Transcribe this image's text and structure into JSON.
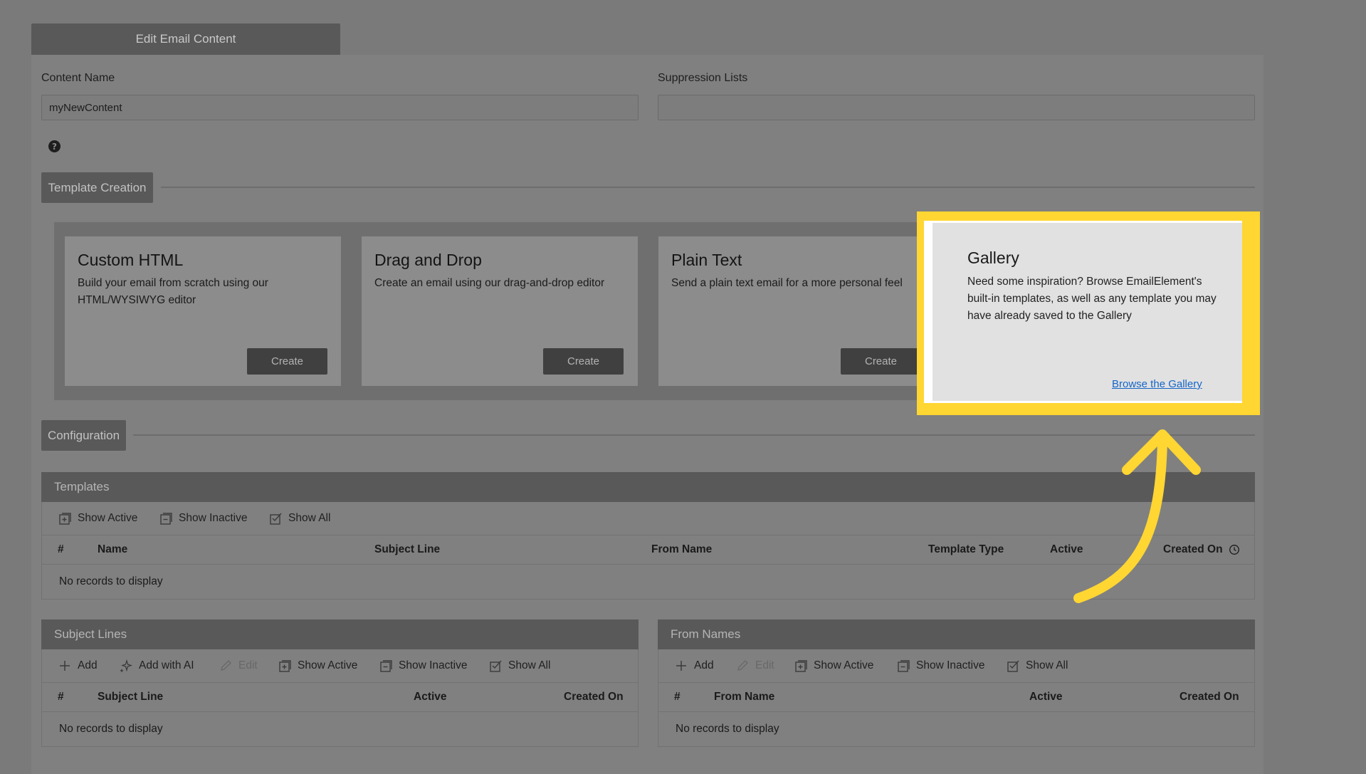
{
  "header": {
    "tab_label": "Edit Email Content"
  },
  "form": {
    "content_name_label": "Content Name",
    "content_name_value": "myNewContent",
    "suppression_label": "Suppression Lists",
    "suppression_value": "",
    "help_glyph": "?"
  },
  "template_creation": {
    "section_label": "Template Creation",
    "cards": [
      {
        "title": "Custom HTML",
        "description": "Build your email from scratch using our HTML/WYSIWYG editor",
        "button": "Create"
      },
      {
        "title": "Drag and Drop",
        "description": "Create an email using our drag-and-drop editor",
        "button": "Create"
      },
      {
        "title": "Plain Text",
        "description": "Send a plain text email for a more personal feel",
        "button": "Create"
      }
    ],
    "gallery": {
      "title": "Gallery",
      "description": "Need some inspiration? Browse EmailElement's built-in templates, as well as any template you may have already saved to the Gallery",
      "link": "Browse the Gallery"
    }
  },
  "configuration": {
    "section_label": "Configuration"
  },
  "templates_grid": {
    "title": "Templates",
    "toolbar": [
      "Show Active",
      "Show Inactive",
      "Show All"
    ],
    "columns": [
      "#",
      "Name",
      "Subject Line",
      "From Name",
      "Template Type",
      "Active",
      "Created On"
    ],
    "empty": "No records to display"
  },
  "subject_lines_grid": {
    "title": "Subject Lines",
    "toolbar": [
      "Add",
      "Add with AI",
      "Edit",
      "Show Active",
      "Show Inactive",
      "Show All"
    ],
    "columns": [
      "#",
      "Subject Line",
      "Active",
      "Created On"
    ],
    "empty": "No records to display"
  },
  "from_names_grid": {
    "title": "From Names",
    "toolbar": [
      "Add",
      "Edit",
      "Show Active",
      "Show Inactive",
      "Show All"
    ],
    "columns": [
      "#",
      "From Name",
      "Active",
      "Created On"
    ],
    "empty": "No records to display"
  },
  "colors": {
    "highlight_frame": "#ffd632",
    "arrow": "#ffd632",
    "link": "#1565c8",
    "overlay_bg": "#7a7a7a"
  }
}
